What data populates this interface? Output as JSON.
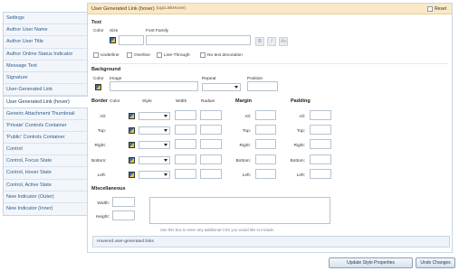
{
  "sidebar": {
    "items": [
      {
        "label": "Settings"
      },
      {
        "label": "Author User Name"
      },
      {
        "label": "Author User Title"
      },
      {
        "label": "Author Online Status Indicator"
      },
      {
        "label": "Message Text"
      },
      {
        "label": "Signature"
      },
      {
        "label": "User-Generated Link"
      },
      {
        "label": "User Generated Link (hover)",
        "active": true
      },
      {
        "label": "Generic Attachment Thumbnail"
      },
      {
        "label": "'Private' Controls Container"
      },
      {
        "label": "'Public' Controls Container"
      },
      {
        "label": "Control"
      },
      {
        "label": "Control, Focus State"
      },
      {
        "label": "Control, Hover State"
      },
      {
        "label": "Control, Active State"
      },
      {
        "label": "New Indicator (Outer)"
      },
      {
        "label": "New Indicator (Inner)"
      }
    ]
  },
  "panel": {
    "title": "User Generated Link (hover)",
    "title_sub": "(ugcLinkHover)",
    "reset_label": "Reset"
  },
  "text_section": {
    "title": "Text",
    "color_label": "Color",
    "size_label": "Size",
    "font_family_label": "Font Family",
    "bold_btn": "B",
    "italic_btn": "I",
    "case_btn": "Aa",
    "underline": "Underline",
    "overline": "Overline",
    "line_through": "Line-Through",
    "no_decoration": "No text decoration"
  },
  "background_section": {
    "title": "Background",
    "color_label": "Color",
    "image_label": "Image",
    "repeat_label": "Repeat",
    "position_label": "Position"
  },
  "border_section": {
    "title": "Border",
    "color_label": "Color",
    "style_label": "Style",
    "width_label": "Width",
    "radius_label": "Radius",
    "rows": [
      "All:",
      "Top:",
      "Right:",
      "Bottom:",
      "Left:"
    ]
  },
  "margin_section": {
    "title": "Margin",
    "rows": [
      "All:",
      "Top:",
      "Right:",
      "Bottom:",
      "Left:"
    ]
  },
  "padding_section": {
    "title": "Padding",
    "rows": [
      "All:",
      "Top:",
      "Right:",
      "Bottom:",
      "Left:"
    ]
  },
  "misc_section": {
    "title": "Miscellaneous",
    "width_label": "Width:",
    "height_label": "Height:",
    "hint": "Use this box to enter any additional CSS you would like to include."
  },
  "description": "Hovered user-generated links",
  "buttons": {
    "update": "Update Style Properties",
    "undo": "Undo Changes"
  },
  "colors": {
    "header_bg": "#f9e9c7",
    "sidebar_text": "#2f5c89",
    "border": "#c8d6e6"
  }
}
